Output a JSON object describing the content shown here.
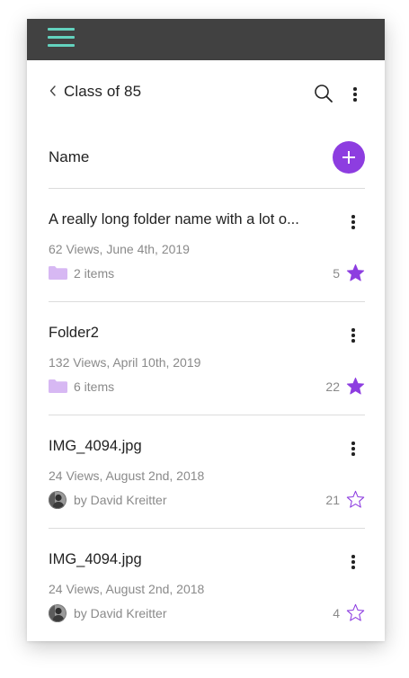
{
  "topbar": {
    "menu_icon": "hamburger-icon"
  },
  "header": {
    "back_icon": "chevron-left-icon",
    "title": "Class of 85",
    "search_icon": "search-icon",
    "more_icon": "more-vertical-icon"
  },
  "list_header": {
    "label": "Name",
    "add_icon": "plus-icon"
  },
  "colors": {
    "topbar": "#414141",
    "menu_icon": "#63d2be",
    "accent": "#8d3de0",
    "folder": "#d7b8f3",
    "meta_text": "#8a8a8a"
  },
  "items": [
    {
      "title": "A really long folder name with a lot o...",
      "meta": "62 Views, June 4th, 2019",
      "foot_icon": "folder-icon",
      "foot_text": "2 items",
      "favorites": "5",
      "starred": true
    },
    {
      "title": "Folder2",
      "meta": "132 Views, April 10th, 2019",
      "foot_icon": "folder-icon",
      "foot_text": "6 items",
      "favorites": "22",
      "starred": true
    },
    {
      "title": "IMG_4094.jpg",
      "meta": "24 Views, August 2nd, 2018",
      "foot_icon": "avatar",
      "foot_text": "by David Kreitter",
      "favorites": "21",
      "starred": false
    },
    {
      "title": "IMG_4094.jpg",
      "meta": "24 Views, August 2nd, 2018",
      "foot_icon": "avatar",
      "foot_text": "by David Kreitter",
      "favorites": "4",
      "starred": false
    }
  ]
}
